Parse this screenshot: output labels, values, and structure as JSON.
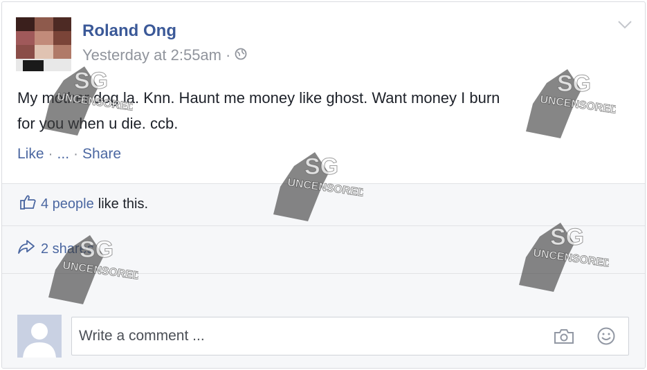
{
  "post": {
    "author": "Roland Ong",
    "timestamp": "Yesterday at 2:55am",
    "meta_separator": "·",
    "privacy_icon": "globe-icon",
    "body_line1": "My mother dog la. Knn. Haunt me money like ghost. Want money I burn",
    "body_line2": "for you when u die. ccb.",
    "options_icon": "chevron-down-icon"
  },
  "actions": {
    "like": "Like",
    "sep": "·",
    "more": "...",
    "share": "Share"
  },
  "summary": {
    "likes_count": "4 people",
    "likes_suffix": "like this.",
    "shares": "2 shares"
  },
  "comment": {
    "placeholder": "Write a comment ...",
    "camera_icon": "camera-icon",
    "emoji_icon": "smiley-icon"
  },
  "watermark": {
    "line1": "SG",
    "line2": "UNCENSORED"
  },
  "colors": {
    "link": "#3b5998",
    "meta": "#90949c",
    "summary_bg": "#f6f7f9"
  }
}
